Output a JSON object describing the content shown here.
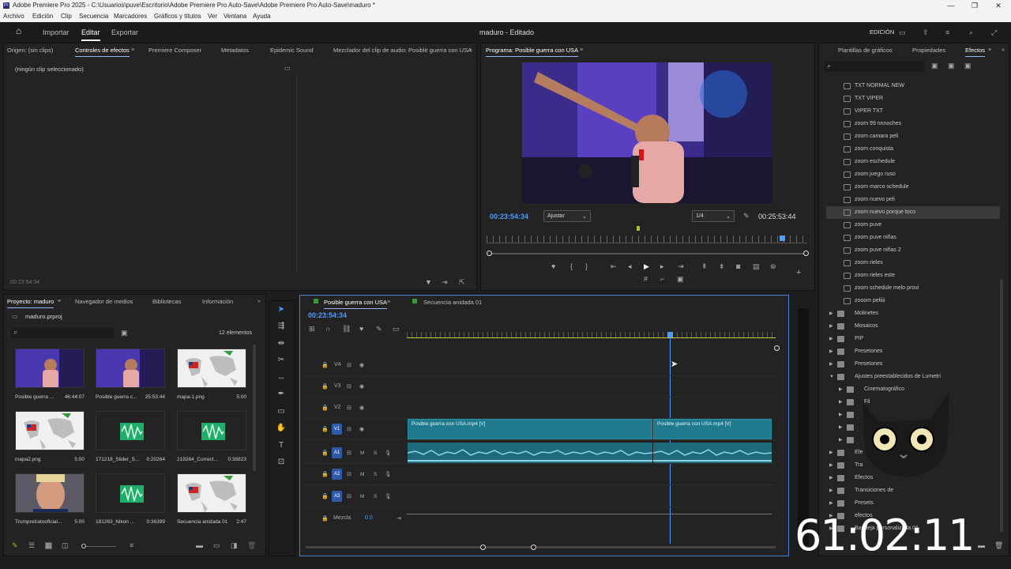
{
  "window": {
    "title": "Adobe Premiere Pro 2025 - C:\\Usuarios\\puve\\Escritorio\\Adobe Premiere Pro Auto-Save\\Adobe Premiere Pro Auto-Save\\maduro *",
    "app_icon": "Pr"
  },
  "menu": [
    "Archivo",
    "Edición",
    "Clip",
    "Secuencia",
    "Marcadores",
    "Gráficos y títulos",
    "Ver",
    "Ventana",
    "Ayuda"
  ],
  "appbar": {
    "home_icon": "home-icon",
    "tabs": [
      "Importar",
      "Editar",
      "Exportar"
    ],
    "active_tab": "Editar",
    "project_title": "maduro - Editado",
    "workspace": "EDICIÓN"
  },
  "source_panel": {
    "tabs": [
      "Origen: (sin clips)",
      "Controles de efectos",
      "Premiere Composer",
      "Metadatos",
      "Epidemic Sound",
      "Mezclador del clip de audio: Posible guerra con USA"
    ],
    "active_tab": "Controles de efectos",
    "message": "(ningún clip seleccionado)",
    "timecode": "00:23:54:34"
  },
  "program_monitor": {
    "title": "Programa: Posible guerra con USA",
    "timecode_left": "00:23:54:34",
    "fit": "Ajustar",
    "resolution": "1/4",
    "timecode_right": "00:25:53:44",
    "playhead_fraction": 0.92
  },
  "effects_panel": {
    "tabs": [
      "Plantillas de gráficos",
      "Propiedades",
      "Efectos"
    ],
    "active_tab": "Efectos",
    "items": [
      {
        "label": "TXT NORMAL NEW",
        "type": "preset"
      },
      {
        "label": "TXT VIPER",
        "type": "preset"
      },
      {
        "label": "VIPER TXT",
        "type": "preset"
      },
      {
        "label": "zoom 99 nnnoches",
        "type": "preset"
      },
      {
        "label": "zoom camara peli",
        "type": "preset"
      },
      {
        "label": "zoom conquista",
        "type": "preset"
      },
      {
        "label": "zoom eschedule",
        "type": "preset"
      },
      {
        "label": "zoom juego ruso",
        "type": "preset"
      },
      {
        "label": "zoom marco schedule",
        "type": "preset"
      },
      {
        "label": "zoom nuevo peli",
        "type": "preset"
      },
      {
        "label": "zoom nuevo porque toco",
        "type": "preset",
        "selected": true
      },
      {
        "label": "zoom puve",
        "type": "preset"
      },
      {
        "label": "zoom puve niñas",
        "type": "preset"
      },
      {
        "label": "zoom puve niñas 2",
        "type": "preset"
      },
      {
        "label": "zoom rieles",
        "type": "preset"
      },
      {
        "label": "zoom rieles este",
        "type": "preset"
      },
      {
        "label": "zoom schedule melo provi",
        "type": "preset"
      },
      {
        "label": "zooom peliiii",
        "type": "preset"
      },
      {
        "label": "Molinetes",
        "type": "folder"
      },
      {
        "label": "Mosaicos",
        "type": "folder"
      },
      {
        "label": "PIP",
        "type": "folder"
      },
      {
        "label": "Presetones",
        "type": "folder"
      },
      {
        "label": "Presetones",
        "type": "folder"
      },
      {
        "label": "Ajustes preestablecidos de Lumetri",
        "type": "folder-open"
      },
      {
        "label": "Cinematográfico",
        "type": "folder"
      },
      {
        "label": "Fil",
        "type": "folder"
      },
      {
        "label": "Mo",
        "type": "folder"
      },
      {
        "label": "Sp",
        "type": "folder"
      },
      {
        "label": "T",
        "type": "folder"
      },
      {
        "label": "Efe",
        "type": "folder"
      },
      {
        "label": "Tra",
        "type": "folder"
      },
      {
        "label": "Efectos",
        "type": "folder"
      },
      {
        "label": "Transiciones de",
        "type": "folder"
      },
      {
        "label": "Presets",
        "type": "folder"
      },
      {
        "label": "efectos",
        "type": "folder"
      },
      {
        "label": "Bandeja personalizada 01",
        "type": "folder"
      }
    ]
  },
  "project_panel": {
    "tabs": [
      "Proyecto: maduro",
      "Navegador de medios",
      "Bibliotecas",
      "Información"
    ],
    "active_tab": "Proyecto: maduro",
    "file": "maduro.prproj",
    "count": "12 elementos",
    "items": [
      {
        "name": "Posible guerra ...",
        "duration": "46:44:07",
        "kind": "video"
      },
      {
        "name": "Posible guerra c...",
        "duration": "25:53:44",
        "kind": "video"
      },
      {
        "name": "mapa-1.png",
        "duration": "5:00",
        "kind": "map"
      },
      {
        "name": "mapa2.png",
        "duration": "5:00",
        "kind": "map-flag"
      },
      {
        "name": "171218_Slider_S...",
        "duration": "0:20264",
        "kind": "audio"
      },
      {
        "name": "219264_Correct...",
        "duration": "0:38823",
        "kind": "audio"
      },
      {
        "name": "Trumpretratooficial...",
        "duration": "5:00",
        "kind": "portrait"
      },
      {
        "name": "181263_Nikon ...",
        "duration": "0:36399",
        "kind": "audio"
      },
      {
        "name": "Secuencia anidada 01",
        "duration": "2:47",
        "kind": "map"
      }
    ]
  },
  "timeline": {
    "tabs": [
      "Posible guerra con USA",
      "Secuencia anidada 01"
    ],
    "active_tab": "Posible guerra con USA",
    "timecode": "00:23:54:34",
    "video_tracks": [
      "V4",
      "V3",
      "V2",
      "V1"
    ],
    "audio_tracks": [
      "A1",
      "A2",
      "A3"
    ],
    "mix_label": "Mezcla",
    "mix_value": "0.0",
    "clips": [
      {
        "label": "Posible guerra con USA.mp4 [V]"
      },
      {
        "label": "Posible guerra con USA.mp4 [V]"
      }
    ],
    "playhead_fraction": 0.72
  },
  "overlay": {
    "timer": "61:02:11"
  },
  "colors": {
    "accent": "#4d9cff",
    "clip_video": "#1f7a8e",
    "clip_audio": "#1e6c7b",
    "timecode": "#4d9cff",
    "sequence_tab": "#3a9a3a"
  }
}
